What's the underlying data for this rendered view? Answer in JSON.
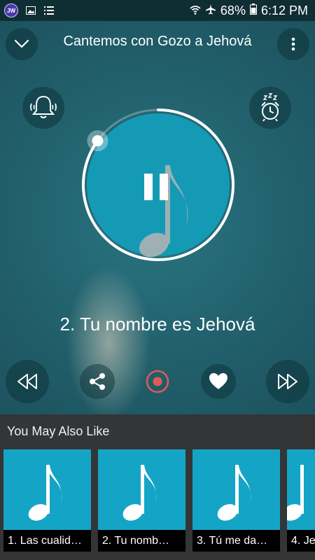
{
  "status_bar": {
    "app_badge": "JW",
    "battery": "68%",
    "time": "6:12 PM"
  },
  "header": {
    "title": "Cantemos con Gozo a Jehová",
    "collapse_icon": "chevron-down-icon",
    "menu_icon": "more-vertical-icon"
  },
  "player": {
    "song_title": "2. Tu nombre es Jehová",
    "progress": 0.85,
    "accent": "#159ab5",
    "record_color": "#e05a5a"
  },
  "controls": {
    "left_icon": "bell-icon",
    "right_icon": "sleep-timer-icon"
  },
  "suggestions": {
    "heading": "You May Also Like",
    "items": [
      {
        "label": "1. Las cualid…"
      },
      {
        "label": "2. Tu nomb…"
      },
      {
        "label": "3. Tú me da…"
      },
      {
        "label": "4. Je"
      }
    ]
  }
}
